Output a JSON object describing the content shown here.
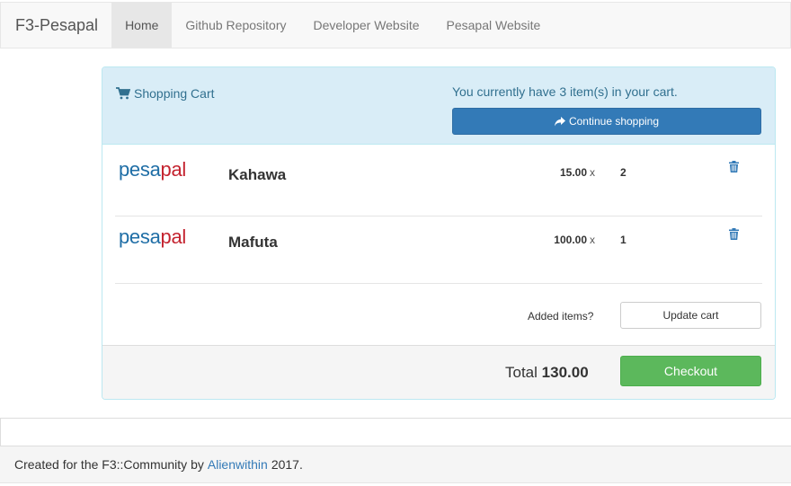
{
  "navbar": {
    "brand": "F3-Pesapal",
    "items": [
      {
        "label": "Home",
        "active": true
      },
      {
        "label": "Github Repository"
      },
      {
        "label": "Developer Website"
      },
      {
        "label": "Pesapal Website"
      }
    ]
  },
  "cart": {
    "title": "Shopping Cart",
    "count_text": "You currently have 3 item(s) in your cart.",
    "continue_label": "Continue shopping",
    "logo": {
      "part1": "pesa",
      "part2": "pal"
    },
    "items": [
      {
        "name": "Kahawa",
        "price": "15.00",
        "x": "x",
        "qty": "2"
      },
      {
        "name": "Mafuta",
        "price": "100.00",
        "x": "x",
        "qty": "1"
      }
    ],
    "added_label": "Added items?",
    "update_label": "Update cart",
    "total_label": "Total",
    "total_value": "130.00",
    "checkout_label": "Checkout"
  },
  "footer": {
    "prefix": "Created for the F3::Community by",
    "link": "Alienwithin",
    "suffix": "2017."
  },
  "colors": {
    "primary": "#337ab7",
    "success": "#5cb85c",
    "info_bg": "#d9edf7",
    "info_text": "#31708f",
    "logo_blue": "#1f6ea6",
    "logo_red": "#c4232f"
  }
}
